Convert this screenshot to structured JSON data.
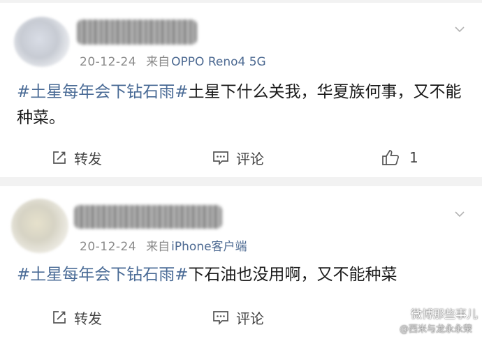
{
  "posts": [
    {
      "date": "20-12-24",
      "via_label": "来自",
      "device": "OPPO Reno4 5G",
      "hashtag": "#土星每年会下钻石雨#",
      "text": "土星下什么关我，华夏族何事，又不能种菜。",
      "actions": {
        "repost": "转发",
        "comment": "评论",
        "like_count": "1"
      }
    },
    {
      "date": "20-12-24",
      "via_label": "来自",
      "device": "iPhone客户端",
      "hashtag": "#土星每年会下钻石雨#",
      "text": "下石油也没用啊，又不能种菜",
      "actions": {
        "repost": "转发",
        "comment": "评论"
      }
    }
  ],
  "watermark": {
    "line1": "微博那些事儿",
    "line2": "@西米与龙永永荣"
  },
  "colors": {
    "link": "#4a6b96",
    "meta": "#8a8a8a",
    "background": "#f2f2f2"
  }
}
